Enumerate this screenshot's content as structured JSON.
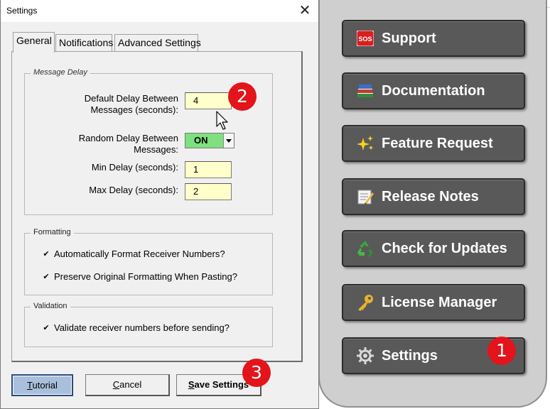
{
  "dialog": {
    "title": "Settings",
    "close_glyph": "✕",
    "tabs": [
      {
        "label": "General",
        "active": true
      },
      {
        "label": "Notifications",
        "active": false
      },
      {
        "label": "Advanced Settings",
        "active": false
      }
    ],
    "message_delay": {
      "group_title": "Message Delay",
      "default_delay_label_line1": "Default Delay Between",
      "default_delay_label_line2": "Messages (seconds):",
      "default_delay_value": "4",
      "random_delay_label_line1": "Random Delay Between",
      "random_delay_label_line2": "Messages:",
      "random_delay_value": "ON",
      "min_delay_label": "Min Delay (seconds):",
      "min_delay_value": "1",
      "max_delay_label": "Max Delay (seconds):",
      "max_delay_value": "2"
    },
    "formatting": {
      "group_title": "Formatting",
      "auto_format_label": "Automatically Format Receiver Numbers?",
      "auto_format_checked": true,
      "preserve_label": "Preserve Original Formatting When Pasting?",
      "preserve_checked": true
    },
    "validation": {
      "group_title": "Validation",
      "validate_label": "Validate receiver numbers before sending?",
      "validate_checked": true
    },
    "buttons": {
      "tutorial_first": "T",
      "tutorial_rest": "utorial",
      "cancel_first": "C",
      "cancel_rest": "ancel",
      "save_first": "S",
      "save_rest": "ave Settings"
    },
    "check_glyph": "✔"
  },
  "sidebar": {
    "items": [
      {
        "label": "Support",
        "icon": "sos-icon"
      },
      {
        "label": "Documentation",
        "icon": "books-icon"
      },
      {
        "label": "Feature Request",
        "icon": "sparkles-icon"
      },
      {
        "label": "Release Notes",
        "icon": "memo-icon"
      },
      {
        "label": "Check for Updates",
        "icon": "recycle-icon"
      },
      {
        "label": "License Manager",
        "icon": "key-icon"
      },
      {
        "label": "Settings",
        "icon": "gear-icon"
      }
    ],
    "sos_text": "SOS"
  },
  "annotations": {
    "badge1": "1",
    "badge2": "2",
    "badge3": "3"
  },
  "colors": {
    "input_bg": "#ffffcc",
    "combo_on": "#7fe07f",
    "badge": "#e3141b",
    "sidebar_button": "#595959"
  }
}
